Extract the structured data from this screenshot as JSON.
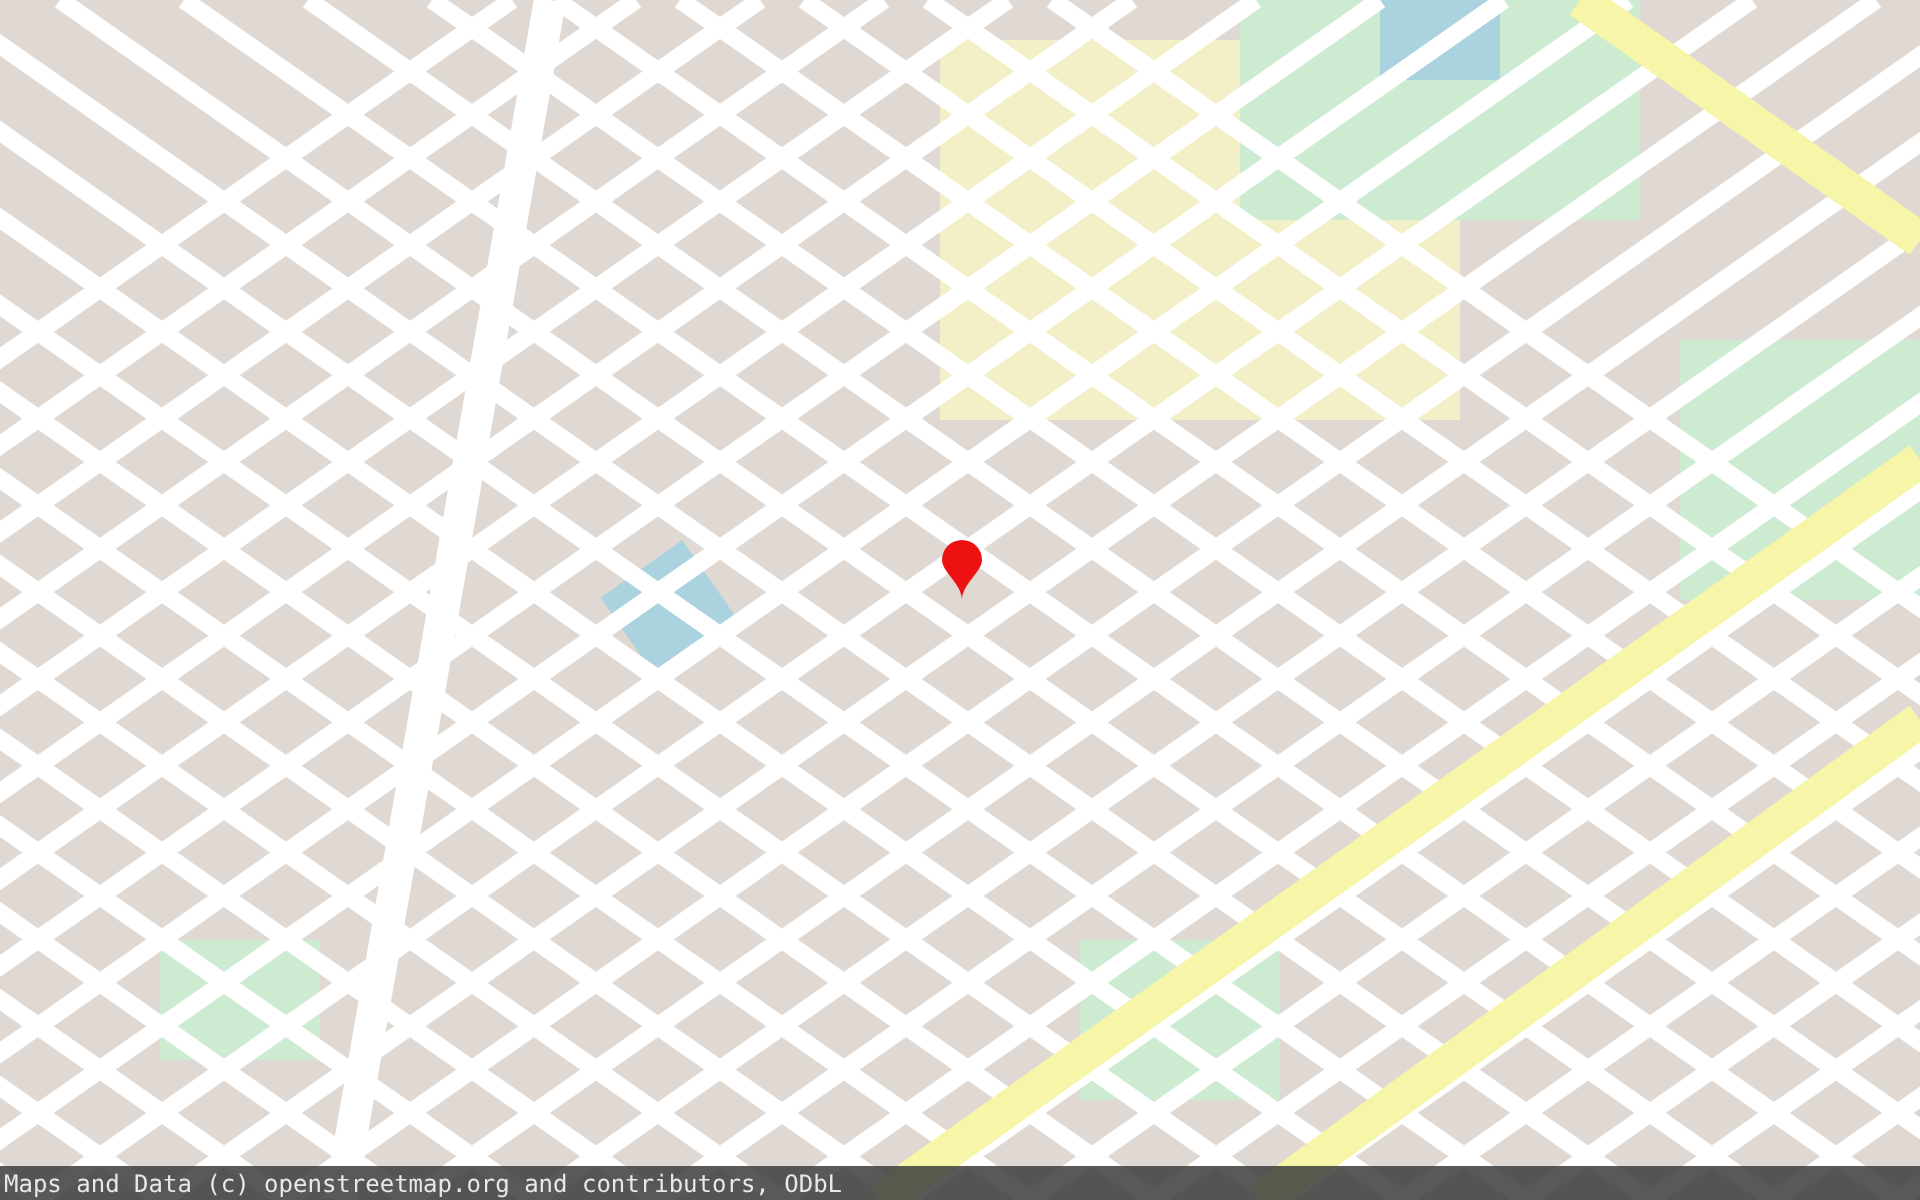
{
  "attribution_bar": {
    "text": "Maps and Data (c) openstreetmap.org and contributors, ODbL"
  }
}
